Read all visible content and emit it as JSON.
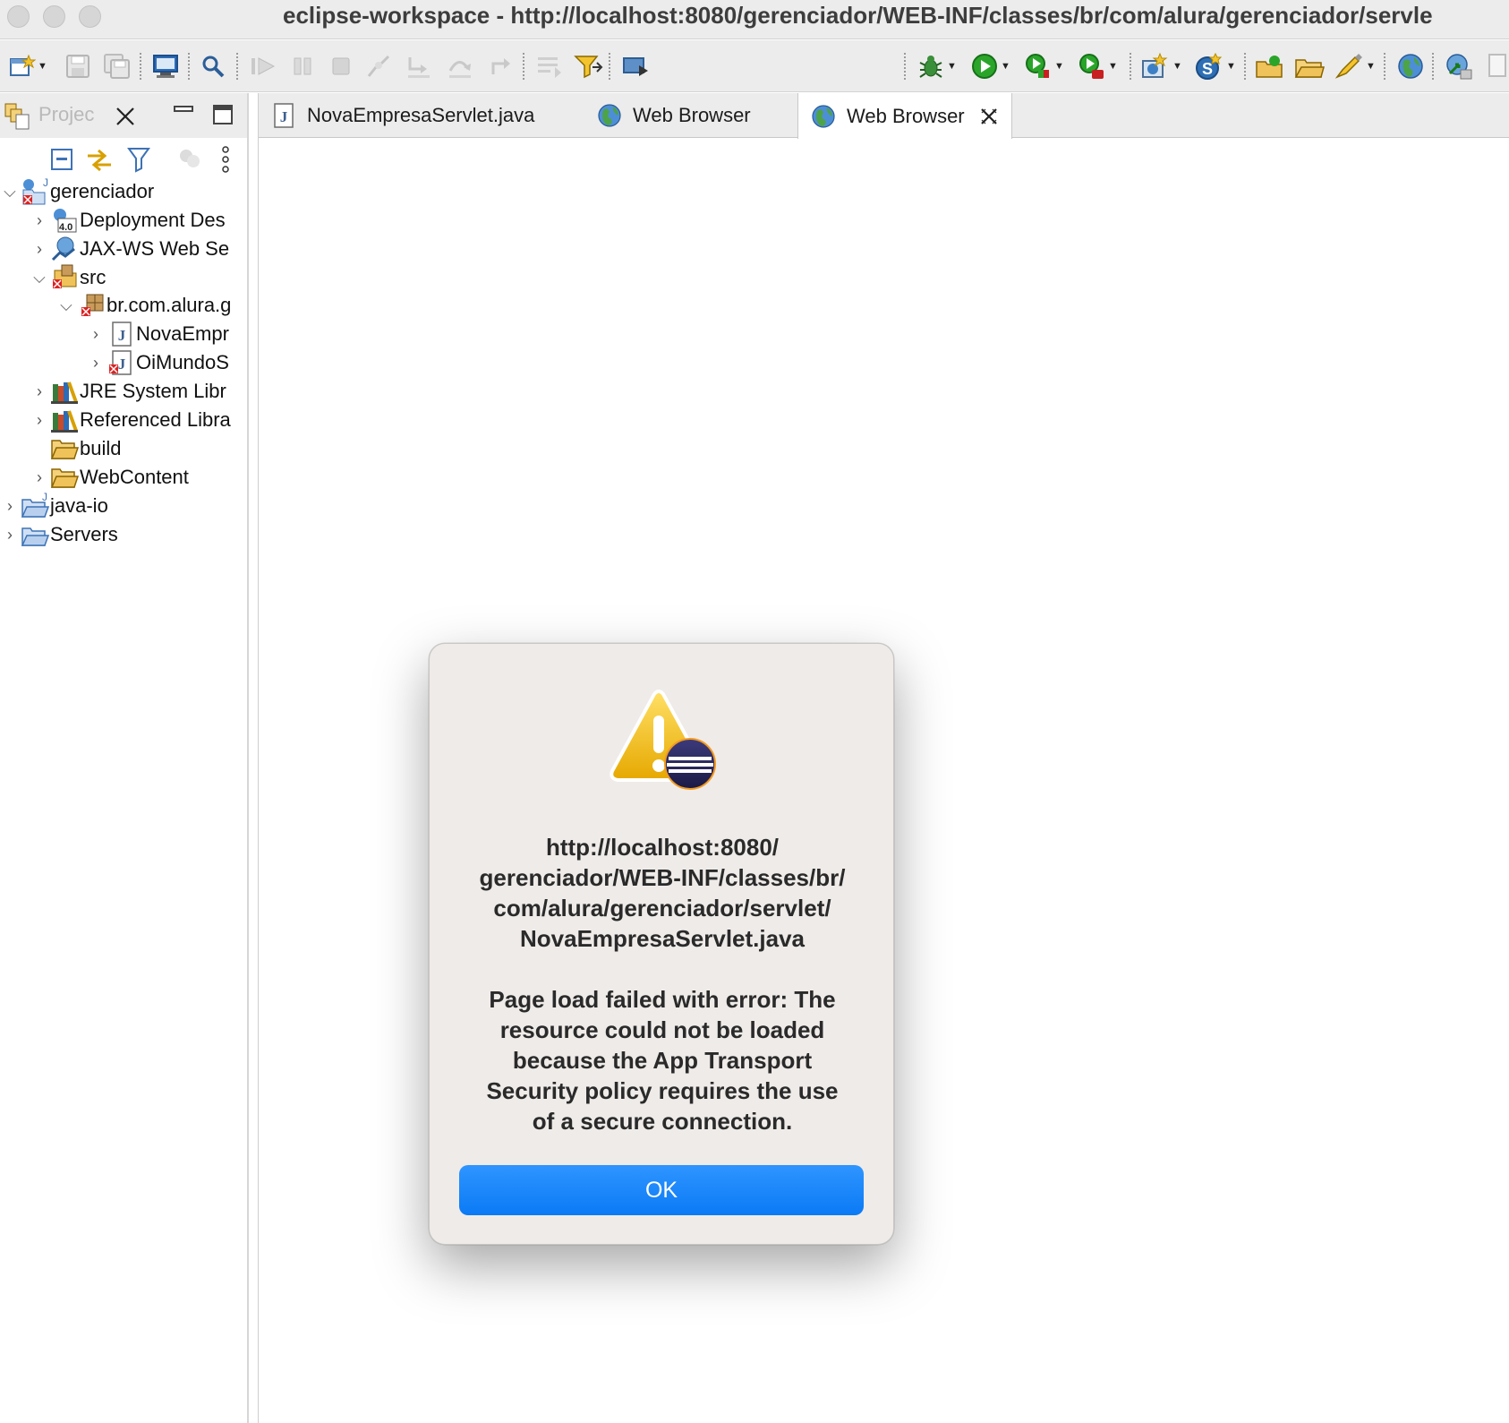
{
  "window": {
    "title": "eclipse-workspace - http://localhost:8080/gerenciador/WEB-INF/classes/br/com/alura/gerenciador/servle"
  },
  "toolbar": {
    "left_icons": [
      "new-wizard-icon",
      "save-icon",
      "save-all-icon",
      "open-terminal-icon",
      "search-icon",
      "resume-icon",
      "suspend-icon",
      "terminate-icon",
      "disconnect-icon",
      "step-into-icon",
      "step-over-icon",
      "step-return-icon",
      "drop-to-frame-icon",
      "use-step-filters-icon",
      "open-perspective-icon"
    ],
    "right_icons": [
      "debug-icon",
      "run-icon",
      "coverage-icon",
      "external-tools-icon",
      "new-java-class-icon",
      "new-web-service-icon",
      "open-type-icon",
      "open-folder-icon",
      "highlighter-icon",
      "web-browser-icon",
      "deploy-icon"
    ]
  },
  "project_explorer": {
    "title": "Projec",
    "tree": [
      {
        "label": "gerenciador",
        "depth": 0,
        "expanded": true,
        "icon": "dynamic-web-project-icon"
      },
      {
        "label": "Deployment Des",
        "depth": 1,
        "expanded": false,
        "icon": "deployment-descriptor-icon"
      },
      {
        "label": "JAX-WS Web Se",
        "depth": 1,
        "expanded": false,
        "icon": "jaxws-icon"
      },
      {
        "label": "src",
        "depth": 1,
        "expanded": true,
        "icon": "source-folder-error-icon"
      },
      {
        "label": "br.com.alura.g",
        "depth": 2,
        "expanded": true,
        "icon": "package-error-icon"
      },
      {
        "label": "NovaEmpr",
        "depth": 3,
        "expanded": false,
        "icon": "java-file-icon"
      },
      {
        "label": "OiMundoS",
        "depth": 3,
        "expanded": false,
        "icon": "java-file-error-icon"
      },
      {
        "label": "JRE System Libr",
        "depth": 1,
        "expanded": false,
        "icon": "library-icon"
      },
      {
        "label": "Referenced Libra",
        "depth": 1,
        "expanded": false,
        "icon": "library-icon"
      },
      {
        "label": "build",
        "depth": 1,
        "expanded": null,
        "icon": "folder-icon"
      },
      {
        "label": "WebContent",
        "depth": 1,
        "expanded": false,
        "icon": "folder-icon"
      },
      {
        "label": "java-io",
        "depth": 0,
        "expanded": false,
        "icon": "java-project-icon"
      },
      {
        "label": "Servers",
        "depth": 0,
        "expanded": false,
        "icon": "folder-blue-icon"
      }
    ]
  },
  "editor": {
    "tabs": [
      {
        "label": "NovaEmpresaServlet.java",
        "icon": "java-file-icon",
        "active": false
      },
      {
        "label": "Web Browser",
        "icon": "globe-icon",
        "active": false
      },
      {
        "label": "Web Browser",
        "icon": "globe-icon",
        "active": true
      }
    ]
  },
  "dialog": {
    "url_lines": [
      "http://localhost:8080/",
      "gerenciador/WEB-INF/classes/br/",
      "com/alura/gerenciador/servlet/",
      "NovaEmpresaServlet.java"
    ],
    "message_lines": [
      "Page load failed with error: The",
      "resource could not be loaded",
      "because the App Transport",
      "Security policy requires the use",
      "of a secure connection."
    ],
    "ok_label": "OK",
    "accent": "#0a7af5"
  }
}
